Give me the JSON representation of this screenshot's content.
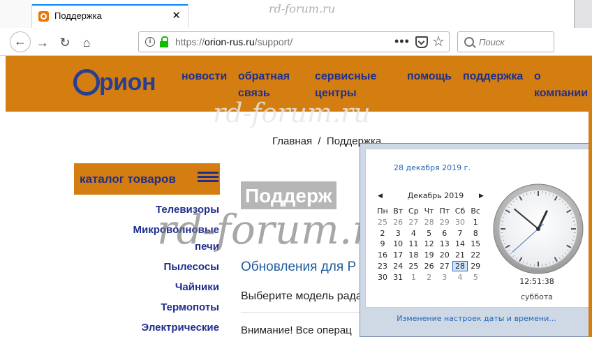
{
  "browser": {
    "tab_title": "Поддержка",
    "tab_close": "✕",
    "url_scheme": "https://",
    "url_host": "orion-rus.ru",
    "url_path": "/support/",
    "search_placeholder": "Поиск",
    "more_label": "•••"
  },
  "watermark": "rd-forum.ru",
  "site": {
    "logo_text": "рион",
    "nav": [
      {
        "line1": "новости",
        "line2": ""
      },
      {
        "line1": "обратная",
        "line2": "связь"
      },
      {
        "line1": "сервисные",
        "line2": "центры"
      },
      {
        "line1": "помощь",
        "line2": ""
      },
      {
        "line1": "поддержка",
        "line2": ""
      },
      {
        "line1": "о",
        "line2": "компании"
      }
    ],
    "breadcrumb": "Главная  /  Поддержка",
    "catalog_label": "каталог товаров",
    "categories": [
      {
        "line1": "Телевизоры",
        "line2": ""
      },
      {
        "line1": "Микроволновые",
        "line2": "печи"
      },
      {
        "line1": "Пылесосы",
        "line2": ""
      },
      {
        "line1": "Чайники",
        "line2": ""
      },
      {
        "line1": "Термопоты",
        "line2": ""
      },
      {
        "line1": "Электрические",
        "line2": ""
      }
    ],
    "page_heading": "Поддерж",
    "section_title": "Обновления для Р",
    "select_model": "Выберите модель рада",
    "warning_text": "Внимание! Все операц"
  },
  "calendar": {
    "date_long": "28 декабря 2019 г.",
    "month_label": "Декабрь 2019",
    "prev_arrow": "◀",
    "next_arrow": "▶",
    "weekdays": [
      "Пн",
      "Вт",
      "Ср",
      "Чт",
      "Пт",
      "Сб",
      "Вс"
    ],
    "weeks": [
      [
        "25",
        "26",
        "27",
        "28",
        "29",
        "30",
        "1"
      ],
      [
        "2",
        "3",
        "4",
        "5",
        "6",
        "7",
        "8"
      ],
      [
        "9",
        "10",
        "11",
        "12",
        "13",
        "14",
        "15"
      ],
      [
        "16",
        "17",
        "18",
        "19",
        "20",
        "21",
        "22"
      ],
      [
        "23",
        "24",
        "25",
        "26",
        "27",
        "28",
        "29"
      ],
      [
        "30",
        "31",
        "1",
        "2",
        "3",
        "4",
        "5"
      ]
    ],
    "dim_days": [
      [
        0,
        0
      ],
      [
        0,
        1
      ],
      [
        0,
        2
      ],
      [
        0,
        3
      ],
      [
        0,
        4
      ],
      [
        0,
        5
      ],
      [
        5,
        2
      ],
      [
        5,
        3
      ],
      [
        5,
        4
      ],
      [
        5,
        5
      ],
      [
        5,
        6
      ]
    ],
    "today": [
      4,
      5
    ],
    "time": "12:51:38",
    "weekday": "суббота",
    "clock_hms": [
      12,
      51,
      38
    ],
    "settings_link": "Изменение настроек даты и времени..."
  }
}
